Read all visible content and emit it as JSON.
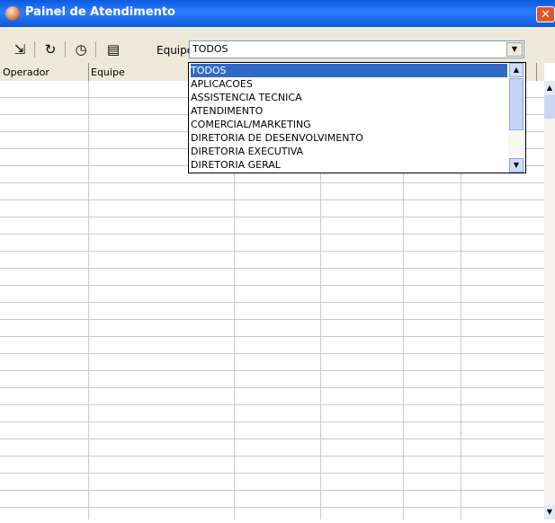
{
  "window": {
    "title": "Painel de Atendimento",
    "close_glyph": "✕",
    "app_icon": "operator-icon"
  },
  "toolbar": {
    "buttons": [
      {
        "icon": "exit-door-icon",
        "glyph": "⇲"
      },
      {
        "icon": "refresh-icon",
        "glyph": "↻"
      },
      {
        "icon": "timer-icon",
        "glyph": "◷"
      },
      {
        "icon": "properties-icon",
        "glyph": "▤"
      }
    ],
    "equipe_label": "Equipe",
    "equipe_value": "TODOS"
  },
  "table": {
    "columns": [
      "Operador",
      "Equipe"
    ]
  },
  "dropdown": {
    "options": [
      "TODOS",
      "APLICACOES",
      "ASSISTENCIA TECNICA",
      "ATENDIMENTO",
      "COMERCIAL/MARKETING",
      "DIRETORIA DE DESENVOLVIMENTO",
      "DIRETORIA EXECUTIVA",
      "DIRETORIA GERAL"
    ],
    "selected_index": 0
  },
  "colors": {
    "title_bar": "#0a5be0",
    "selection": "#316ac5",
    "toolbar_bg": "#ece9d8"
  }
}
